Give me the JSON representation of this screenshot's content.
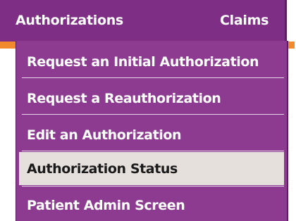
{
  "navbar": {
    "items": [
      {
        "label": "Authorizations"
      },
      {
        "label": "Claims"
      }
    ]
  },
  "dropdown": {
    "items": [
      {
        "label": "Request an Initial Authorization",
        "selected": false
      },
      {
        "label": "Request a Reauthorization",
        "selected": false
      },
      {
        "label": "Edit an Authorization",
        "selected": false
      },
      {
        "label": "Authorization Status",
        "selected": true
      },
      {
        "label": "Patient Admin Screen",
        "selected": false
      }
    ]
  },
  "colors": {
    "nav_purple": "#7e2f85",
    "menu_purple": "#8d3b91",
    "accent_orange": "#f08a2c",
    "selected_bg": "#e6e0dd"
  }
}
